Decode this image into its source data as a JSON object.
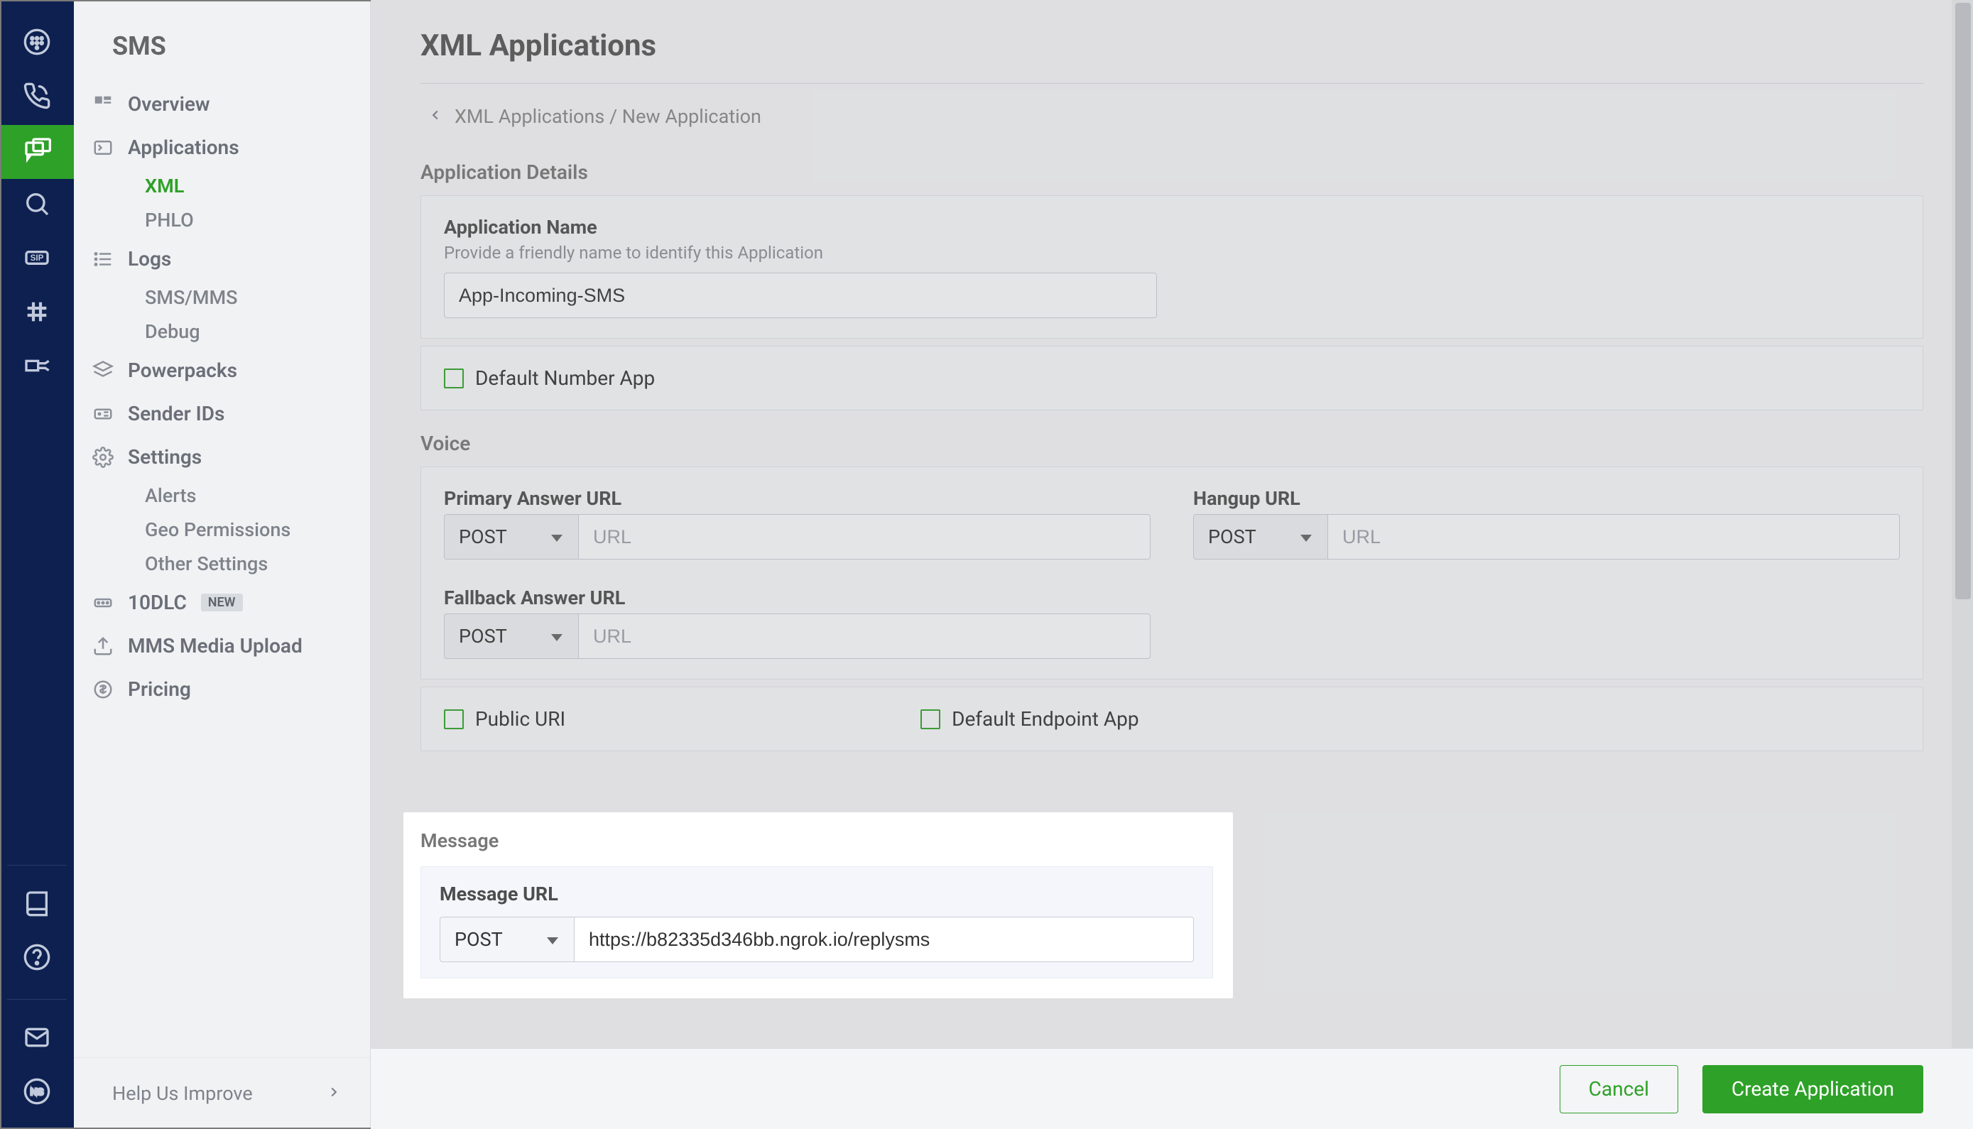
{
  "rail": {
    "active_index": 2
  },
  "sidebar": {
    "title": "SMS",
    "items": {
      "overview": "Overview",
      "applications": "Applications",
      "xml": "XML",
      "phlo": "PHLO",
      "logs": "Logs",
      "smsmms": "SMS/MMS",
      "debug": "Debug",
      "powerpacks": "Powerpacks",
      "senderids": "Sender IDs",
      "settings": "Settings",
      "alerts": "Alerts",
      "geo": "Geo Permissions",
      "other": "Other Settings",
      "tendlc": "10DLC",
      "tendlc_badge": "NEW",
      "mms": "MMS Media Upload",
      "pricing": "Pricing"
    },
    "footer": "Help Us Improve"
  },
  "page": {
    "title": "XML Applications",
    "breadcrumb": "XML Applications / New Application",
    "app_details_label": "Application Details",
    "appname_label": "Application Name",
    "appname_help": "Provide a friendly name to identify this Application",
    "appname_value": "App-Incoming-SMS",
    "default_number_app": "Default Number App",
    "voice_label": "Voice",
    "primary_label": "Primary Answer URL",
    "hangup_label": "Hangup URL",
    "fallback_label": "Fallback Answer URL",
    "method_post": "POST",
    "url_placeholder": "URL",
    "public_uri": "Public URI",
    "default_endpoint_app": "Default Endpoint App",
    "message_label": "Message",
    "message_url_label": "Message URL",
    "message_url_value": "https://b82335d346bb.ngrok.io/replysms",
    "cancel": "Cancel",
    "create": "Create Application"
  },
  "colors": {
    "brand": "#2ea128",
    "rail_bg": "#0d2050"
  }
}
